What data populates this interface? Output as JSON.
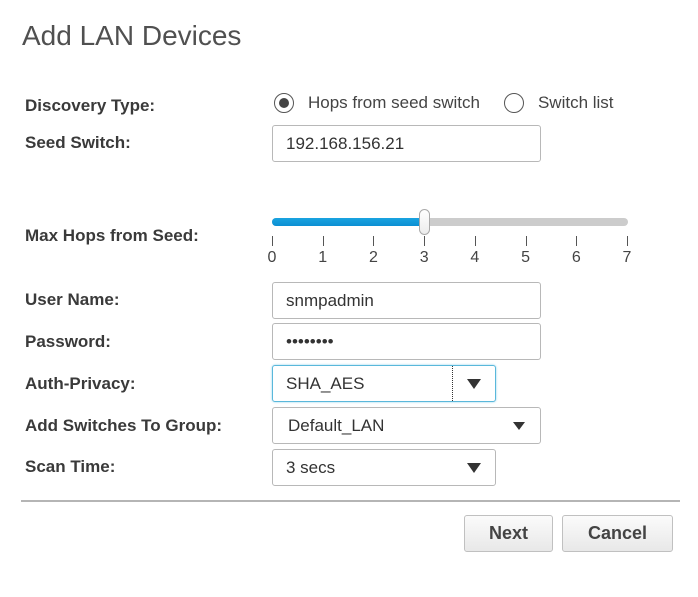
{
  "dialog": {
    "title": "Add LAN Devices"
  },
  "form": {
    "discovery_type": {
      "label": "Discovery Type:",
      "options": [
        {
          "label": "Hops from seed switch",
          "selected": true
        },
        {
          "label": "Switch list",
          "selected": false
        }
      ]
    },
    "seed_switch": {
      "label": "Seed Switch:",
      "value": "192.168.156.21"
    },
    "max_hops": {
      "label": "Max Hops from Seed:",
      "value": 3,
      "min": 0,
      "max": 7,
      "ticks": [
        "0",
        "1",
        "2",
        "3",
        "4",
        "5",
        "6",
        "7"
      ],
      "fill_color": "#0b8fd3"
    },
    "user_name": {
      "label": "User Name:",
      "value": "snmpadmin"
    },
    "password": {
      "label": "Password:",
      "value": "••••••••"
    },
    "auth_privacy": {
      "label": "Auth-Privacy:",
      "value": "SHA_AES"
    },
    "group": {
      "label": "Add Switches To Group:",
      "value": "Default_LAN"
    },
    "scan_time": {
      "label": "Scan Time:",
      "value": "3 secs"
    }
  },
  "buttons": {
    "next": "Next",
    "cancel": "Cancel"
  }
}
